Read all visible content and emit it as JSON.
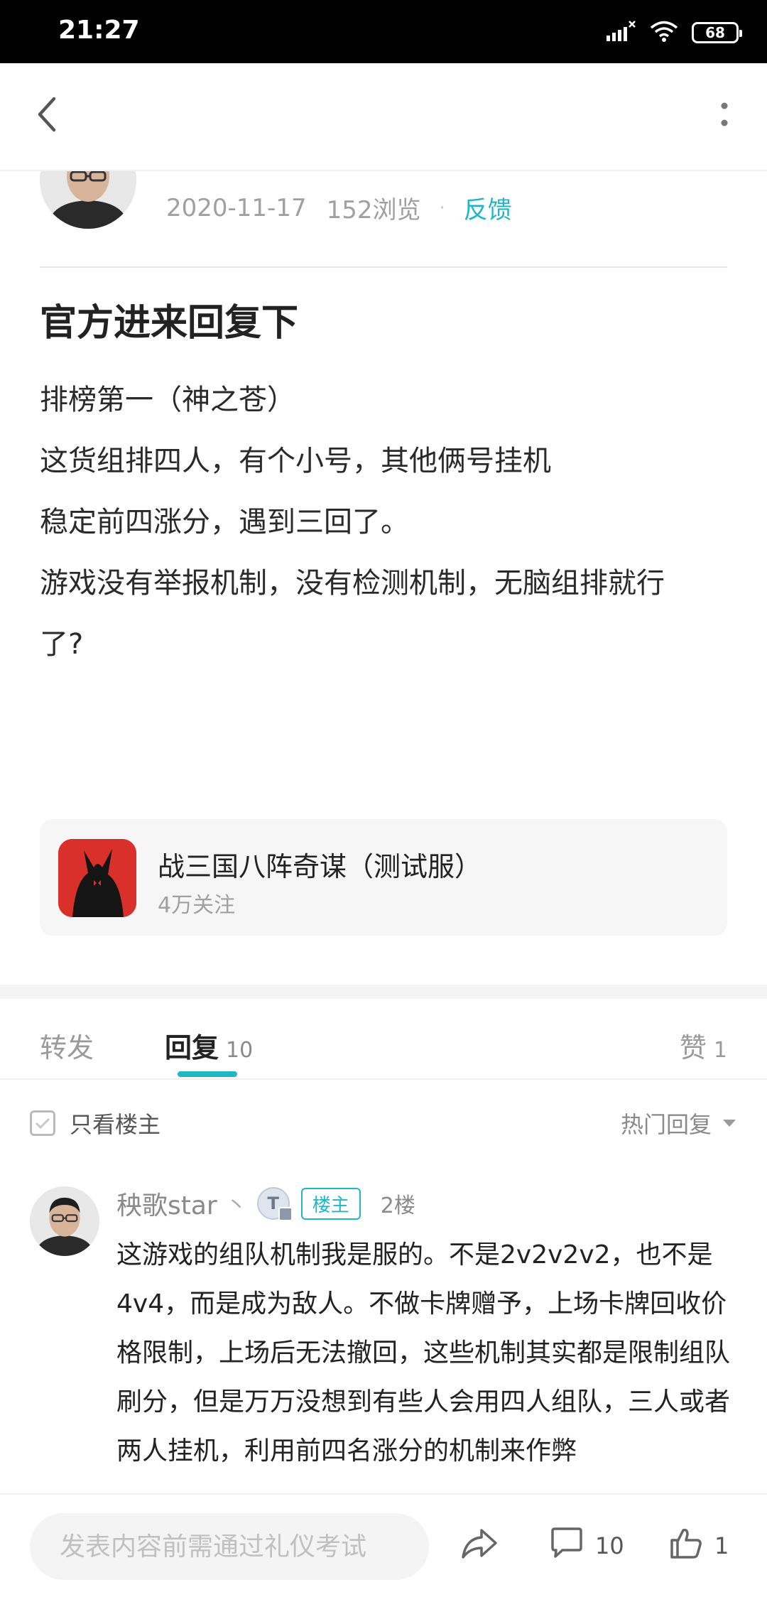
{
  "status_bar": {
    "time": "21:27",
    "battery": "68"
  },
  "nav": {
    "back_icon": "chevron-left-icon",
    "more_icon": "more-vertical-icon"
  },
  "post": {
    "date": "2020-11-17",
    "views": "152浏览",
    "meta_separator": "·",
    "feedback": "反馈",
    "title": "官方进来回复下",
    "body_lines": [
      "排榜第一（神之苍）",
      "这货组排四人，有个小号，其他俩号挂机",
      "稳定前四涨分，遇到三回了。",
      "游戏没有举报机制，没有检测机制，无脑组排就行",
      "了?"
    ]
  },
  "game_card": {
    "name": "战三国八阵奇谋（测试服）",
    "followers": "4万关注"
  },
  "tabs": {
    "forward": "转发",
    "reply": "回复",
    "reply_count": "10",
    "like": "赞",
    "like_count": "1"
  },
  "filter": {
    "op_only": "只看楼主",
    "sort": "热门回复"
  },
  "reply": {
    "username": "秧歌star",
    "separator": "丶",
    "level_badge": "T",
    "op_badge": "楼主",
    "floor": "2楼",
    "text": "这游戏的组队机制我是服的。不是2v2v2v2，也不是4v4，而是成为敌人。不做卡牌赠予，上场卡牌回收价格限制，上场后无法撤回，这些机制其实都是限制组队刷分，但是万万没想到有些人会用四人组队，三人或者两人挂机，利用前四名涨分的机制来作弊"
  },
  "bottom_bar": {
    "input_placeholder": "发表内容前需通过礼仪考试",
    "comment_count": "10",
    "like_count": "1"
  },
  "colors": {
    "accent": "#1fb6c8",
    "muted": "#a0a0a0",
    "game_icon_red": "#d9302b"
  }
}
